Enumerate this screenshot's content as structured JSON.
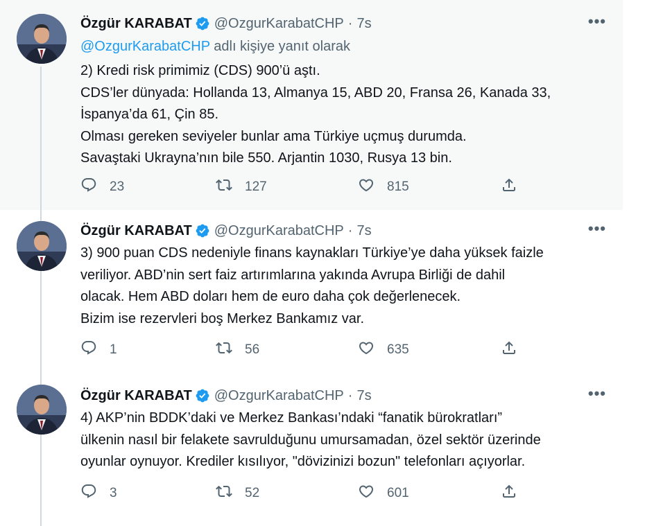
{
  "tweets": [
    {
      "author_name": "Özgür KARABAT",
      "handle": "@OzgurKarabatCHP",
      "separator": "·",
      "time": "7s",
      "more": "•••",
      "reply_to": {
        "mention": "@OzgurKarabatCHP",
        "suffix": "adlı kişiye yanıt olarak"
      },
      "lines": [
        "2) Kredi risk primimiz (CDS) 900’ü aştı.",
        "CDS’ler dünyada: Hollanda 13, Almanya 15, ABD 20, Fransa 26, Kanada 33,",
        "İspanya’da 61, Çin 85.",
        "Olması gereken seviyeler bunlar ama Türkiye uçmuş durumda.",
        "Savaştaki Ukrayna’nın bile 550. Arjantin 1030, Rusya 13 bin."
      ],
      "replies": "23",
      "retweets": "127",
      "likes": "815"
    },
    {
      "author_name": "Özgür KARABAT",
      "handle": "@OzgurKarabatCHP",
      "separator": "·",
      "time": "7s",
      "more": "•••",
      "lines": [
        "3) 900 puan CDS nedeniyle finans kaynakları Türkiye’ye daha yüksek faizle",
        "veriliyor. ABD’nin sert faiz artırımlarına yakında Avrupa Birliği de dahil",
        "olacak. Hem ABD doları hem de euro daha çok değerlenecek.",
        "Bizim ise rezervleri boş Merkez Bankamız var."
      ],
      "replies": "1",
      "retweets": "56",
      "likes": "635"
    },
    {
      "author_name": "Özgür KARABAT",
      "handle": "@OzgurKarabatCHP",
      "separator": "·",
      "time": "7s",
      "more": "•••",
      "lines": [
        "4) AKP’nin BDDK’daki ve Merkez Bankası’ndaki “fanatik bürokratları”",
        "ülkenin nasıl bir felakete savrulduğunu umursamadan, özel sektör üzerinde",
        "oyunlar oynuyor. Krediler kısılıyor, \"dövizinizi bozun\" telefonları açıyorlar."
      ],
      "replies": "3",
      "retweets": "52",
      "likes": "601"
    }
  ],
  "icons": {
    "verified": "verified-badge-icon",
    "reply": "reply-bubble-icon",
    "retweet": "retweet-arrows-icon",
    "like": "heart-icon",
    "share": "share-upload-icon",
    "more": "more-horizontal-icon"
  },
  "colors": {
    "accent": "#1d9bf0",
    "muted_text": "#536471",
    "highlight_bg": "#f7f9f9",
    "thread_line": "#cfd9de"
  }
}
